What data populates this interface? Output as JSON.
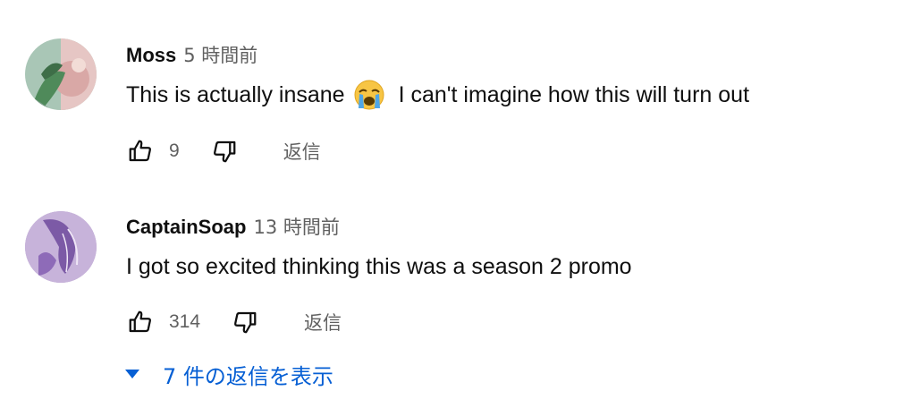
{
  "comments": [
    {
      "author": "Moss",
      "time": "5 時間前",
      "text_before_emoji": "This is actually insane",
      "emoji": "crying-face-emoji",
      "text_after_emoji": "I can't imagine how this will turn out",
      "like_count": "9",
      "reply_label": "返信"
    },
    {
      "author": "CaptainSoap",
      "time": "13 時間前",
      "text": "I got so excited thinking this was a season 2 promo",
      "like_count": "314",
      "reply_label": "返信"
    }
  ],
  "view_replies": {
    "label": "7 件の返信を表示",
    "icon": "caret-down-icon"
  },
  "colors": {
    "text_primary": "#0f0f0f",
    "text_secondary": "#606060",
    "link_blue": "#065fd4",
    "background": "#ffffff"
  },
  "icons": [
    "thumbs-up-icon",
    "thumbs-down-icon",
    "caret-down-icon"
  ]
}
